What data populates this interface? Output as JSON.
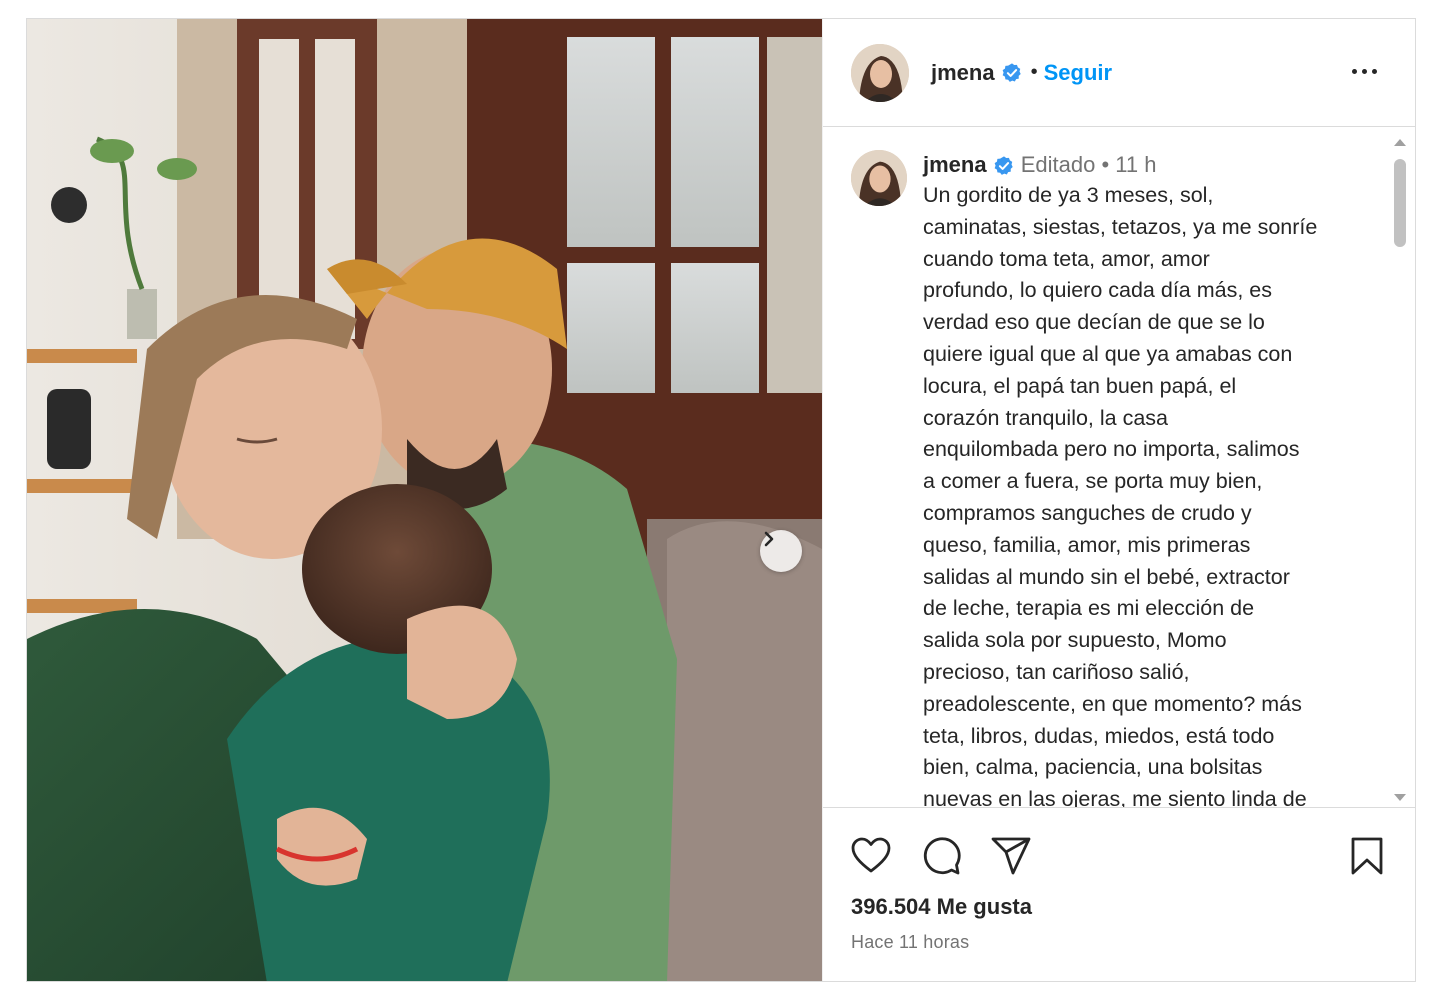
{
  "post": {
    "username": "jmena",
    "follow_label": "Seguir",
    "separator": "•",
    "caption": {
      "edited_label": "Editado",
      "separator": "•",
      "time_ago": "11 h",
      "lines": [
        "Un gordito de ya 3 meses, sol,",
        "caminatas, siestas, tetazos, ya me sonríe",
        "cuando toma teta, amor, amor",
        "profundo, lo quiero cada día más, es",
        "verdad eso que decían de que se lo",
        "quiere igual que al que ya amabas con",
        "locura, el papá tan buen papá, el",
        "corazón tranquilo, la casa",
        "enquilombada pero no importa, salimos",
        "a comer a fuera, se porta muy bien,",
        "compramos sanguches de crudo y",
        "queso, familia, amor, mis primeras",
        "salidas al mundo sin el bebé, extractor",
        "de leche, terapia es mi elección de",
        "salida sola por supuesto, Momo",
        "precioso, tan cariñoso salió,",
        "preadolescente, en que momento? más",
        "teta, libros, dudas, miedos, está todo",
        "bien, calma, paciencia, una bolsitas",
        "nuevas en las ojeras, me siento linda de"
      ]
    },
    "likes_text": "396.504 Me gusta",
    "posted_text": "Hace 11 horas"
  },
  "icons": {
    "verified": "verified-badge-icon",
    "more": "more-options-icon",
    "like": "heart-icon",
    "comment": "comment-icon",
    "share": "send-icon",
    "save": "bookmark-icon",
    "next": "chevron-right-icon"
  },
  "colors": {
    "accent": "#0095f6",
    "text": "#262626",
    "muted": "#737373",
    "border": "#dbdbdb"
  }
}
